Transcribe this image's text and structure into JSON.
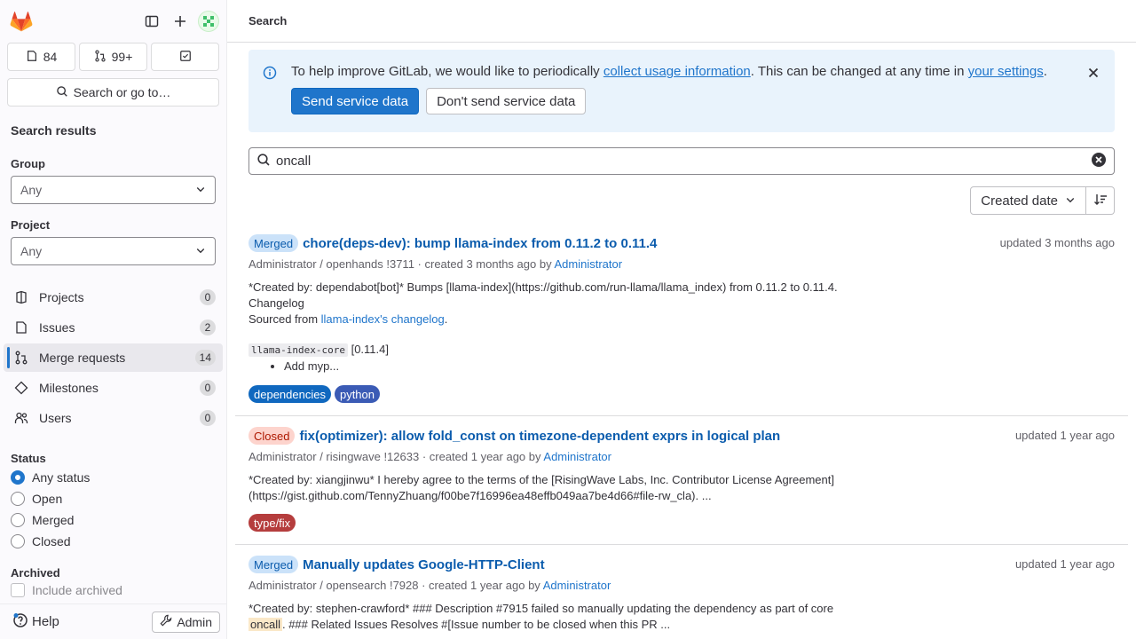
{
  "sidebar": {
    "counts": {
      "issues": "84",
      "merge_requests": "99+"
    },
    "search_go_label": "Search or go to…",
    "title": "Search results",
    "group_label": "Group",
    "group_value": "Any",
    "project_label": "Project",
    "project_value": "Any",
    "nav": [
      {
        "label": "Projects",
        "count": "0"
      },
      {
        "label": "Issues",
        "count": "2"
      },
      {
        "label": "Merge requests",
        "count": "14"
      },
      {
        "label": "Milestones",
        "count": "0"
      },
      {
        "label": "Users",
        "count": "0"
      }
    ],
    "status_label": "Status",
    "status_options": [
      "Any status",
      "Open",
      "Merged",
      "Closed"
    ],
    "archived_label": "Archived",
    "include_archived_label": "Include archived",
    "help_label": "Help",
    "admin_label": "Admin"
  },
  "topbar": {
    "title": "Search"
  },
  "alert": {
    "text_before": "To help improve GitLab, we would like to periodically ",
    "link1": "collect usage information",
    "text_mid": ". This can be changed at any time in ",
    "link2": "your settings",
    "text_after": ".",
    "primary": "Send service data",
    "secondary": "Don't send service data"
  },
  "search": {
    "query": "oncall"
  },
  "sort": {
    "label": "Created date"
  },
  "results": [
    {
      "state": "Merged",
      "title": "chore(deps-dev): bump llama-index from 0.11.2 to 0.11.4",
      "updated": "updated 3 months ago",
      "meta_path": "Administrator / openhands !3711 · created 3 months ago by ",
      "meta_author": "Administrator",
      "desc_line1": "*Created by: dependabot[bot]* Bumps [llama-index](https://github.com/run-llama/llama_index) from 0.11.2 to 0.11.4.",
      "desc_line2": "Changelog",
      "desc_line3_pre": "Sourced from ",
      "desc_line3_link": "llama-index's changelog",
      "desc_line3_post": ".",
      "code": "llama-index-core",
      "code_after": " [0.11.4]",
      "bullet": "Add myp...",
      "labels": [
        {
          "text": "dependencies",
          "color": "#1068bf"
        },
        {
          "text": "python",
          "color": "#3b5bb5"
        }
      ]
    },
    {
      "state": "Closed",
      "title": "fix(optimizer): allow fold_const on timezone-dependent exprs in logical plan",
      "updated": "updated 1 year ago",
      "meta_path": "Administrator / risingwave !12633 · created 1 year ago by ",
      "meta_author": "Administrator",
      "desc_line1": "*Created by: xiangjinwu* I hereby agree to the terms of the [RisingWave Labs, Inc. Contributor License Agreement]",
      "desc_line2": "(https://gist.github.com/TennyZhuang/f00be7f16996ea48effb049aa7be4d66#file-rw_cla). ...",
      "labels": [
        {
          "text": "type/fix",
          "color": "#b53d3d"
        }
      ]
    },
    {
      "state": "Merged",
      "title": "Manually updates Google-HTTP-Client",
      "updated": "updated 1 year ago",
      "meta_path": "Administrator / opensearch !7928 · created 1 year ago by ",
      "meta_author": "Administrator",
      "desc_line1": "*Created by: stephen-crawford* ### Description #7915 failed so manually updating the dependency as part of core",
      "desc_hl": "oncall",
      "desc_line2": ". ### Related Issues Resolves #[Issue number to be closed when this PR ..."
    }
  ],
  "colors": {
    "accent": "#1f75cb",
    "merged_bg": "#cbe2f9",
    "closed_bg": "#fdd4cd",
    "alert_bg": "#e9f3fc"
  }
}
